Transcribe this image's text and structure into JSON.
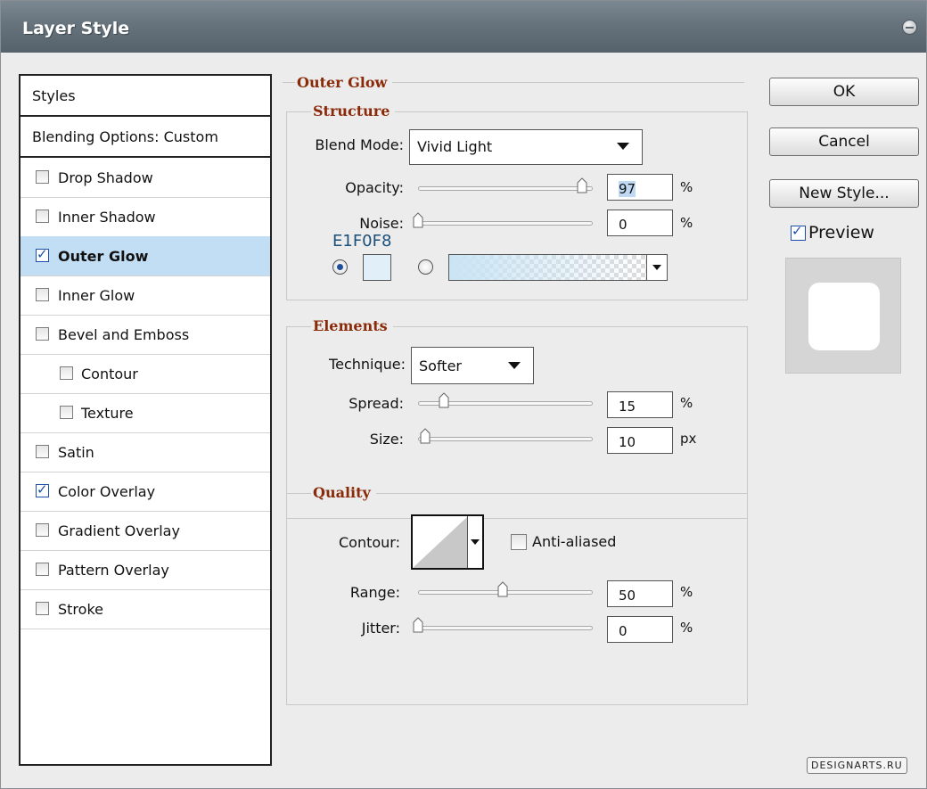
{
  "window": {
    "title": "Layer Style"
  },
  "styles_panel": {
    "header": "Styles",
    "blending": "Blending Options: Custom",
    "items": [
      {
        "label": "Drop Shadow",
        "checked": false,
        "selected": false,
        "indent": false
      },
      {
        "label": "Inner Shadow",
        "checked": false,
        "selected": false,
        "indent": false
      },
      {
        "label": "Outer Glow",
        "checked": true,
        "selected": true,
        "indent": false
      },
      {
        "label": "Inner Glow",
        "checked": false,
        "selected": false,
        "indent": false
      },
      {
        "label": "Bevel and Emboss",
        "checked": false,
        "selected": false,
        "indent": false
      },
      {
        "label": "Contour",
        "checked": false,
        "selected": false,
        "indent": true
      },
      {
        "label": "Texture",
        "checked": false,
        "selected": false,
        "indent": true
      },
      {
        "label": "Satin",
        "checked": false,
        "selected": false,
        "indent": false
      },
      {
        "label": "Color Overlay",
        "checked": true,
        "selected": false,
        "indent": false
      },
      {
        "label": "Gradient Overlay",
        "checked": false,
        "selected": false,
        "indent": false
      },
      {
        "label": "Pattern Overlay",
        "checked": false,
        "selected": false,
        "indent": false
      },
      {
        "label": "Stroke",
        "checked": false,
        "selected": false,
        "indent": false
      }
    ]
  },
  "outer_glow": {
    "title": "Outer Glow",
    "structure": {
      "title": "Structure",
      "blend_mode_label": "Blend Mode:",
      "blend_mode": "Vivid Light",
      "opacity_label": "Opacity:",
      "opacity": "97",
      "opacity_unit": "%",
      "opacity_level": 0.97,
      "noise_label": "Noise:",
      "noise": "0",
      "noise_unit": "%",
      "noise_level": 0,
      "color_hex_label": "E1F0F8",
      "color": "#E1F0F8"
    },
    "elements": {
      "title": "Elements",
      "technique_label": "Technique:",
      "technique": "Softer",
      "spread_label": "Spread:",
      "spread": "15",
      "spread_unit": "%",
      "spread_level": 0.15,
      "size_label": "Size:",
      "size": "10",
      "size_unit": "px",
      "size_level": 0.04
    },
    "quality": {
      "title": "Quality",
      "contour_label": "Contour:",
      "antialiased_label": "Anti-aliased",
      "antialiased": false,
      "range_label": "Range:",
      "range": "50",
      "range_unit": "%",
      "range_level": 0.5,
      "jitter_label": "Jitter:",
      "jitter": "0",
      "jitter_unit": "%",
      "jitter_level": 0
    }
  },
  "buttons": {
    "ok": "OK",
    "cancel": "Cancel",
    "new_style": "New Style..."
  },
  "preview": {
    "label": "Preview",
    "checked": true
  },
  "watermark": "DESIGNARTS.RU"
}
